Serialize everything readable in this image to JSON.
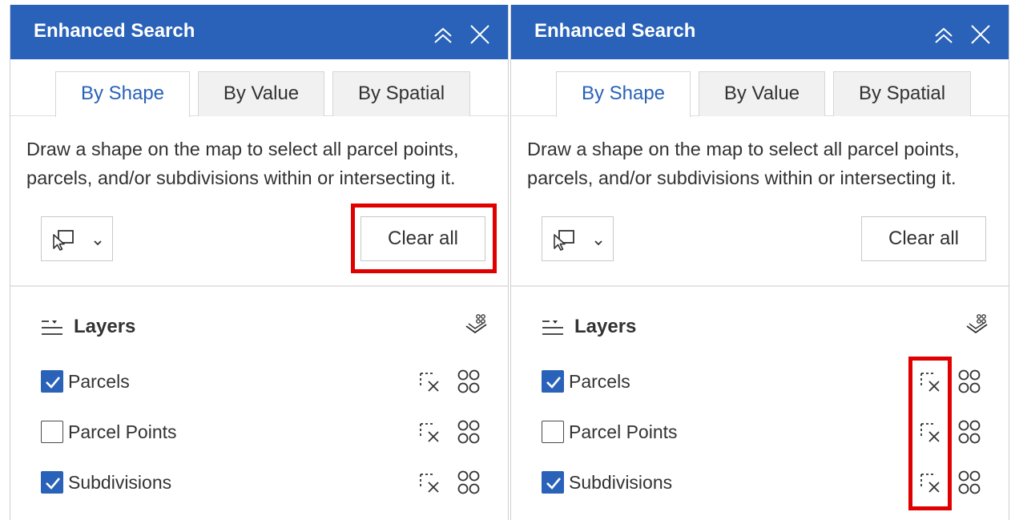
{
  "panels": [
    {
      "id": "left",
      "title": "Enhanced Search",
      "tabs": [
        "By Shape",
        "By Value",
        "By Spatial"
      ],
      "active_tab": "By Shape",
      "description": "Draw a shape on the map to select all parcel points, parcels, and/or subdivisions within or intersecting it.",
      "clear_label": "Clear all",
      "layers_title": "Layers",
      "layers": [
        {
          "label": "Parcels",
          "checked": true
        },
        {
          "label": "Parcel Points",
          "checked": false
        },
        {
          "label": "Subdivisions",
          "checked": true
        }
      ],
      "highlight": "clear-all-button"
    },
    {
      "id": "right",
      "title": "Enhanced Search",
      "tabs": [
        "By Shape",
        "By Value",
        "By Spatial"
      ],
      "active_tab": "By Shape",
      "description": "Draw a shape on the map to select all parcel points, parcels, and/or subdivisions within or intersecting it.",
      "clear_label": "Clear all",
      "layers_title": "Layers",
      "layers": [
        {
          "label": "Parcels",
          "checked": true
        },
        {
          "label": "Parcel Points",
          "checked": false
        },
        {
          "label": "Subdivisions",
          "checked": true
        }
      ],
      "highlight": "layer-clear-selection-icons"
    }
  ],
  "icons": {
    "collapse": "chevron-double-up-icon",
    "close": "close-icon",
    "draw_tool": "select-by-rectangle-icon",
    "dropdown": "chevron-down-icon",
    "layers": "layer-list-icon",
    "select_all_layers": "select-all-layers-icon",
    "clear_selection": "clear-selection-icon",
    "select_features": "select-features-icon",
    "checkbox_checked": "checkbox-checked-icon"
  },
  "colors": {
    "header_bg": "#2962b8",
    "active_tab_text": "#2962b8",
    "checkbox_fill": "#2962b8",
    "highlight_box": "#e00000"
  }
}
